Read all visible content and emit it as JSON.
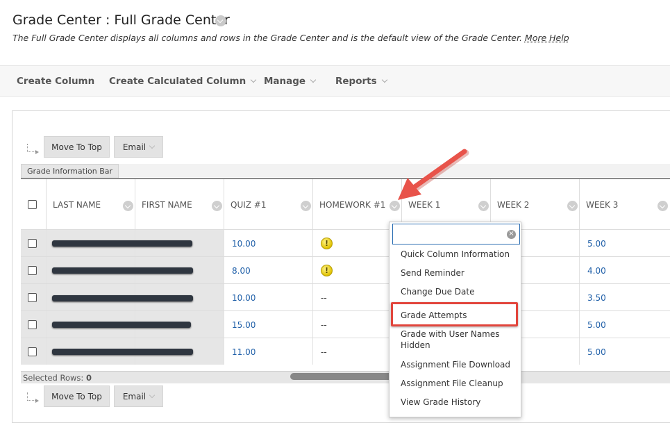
{
  "header": {
    "title": "Grade Center : Full Grade Center",
    "description": "The Full Grade Center displays all columns and rows in the Grade Center and is the default view of the Grade Center.",
    "more_help": "More Help"
  },
  "action_bar": {
    "create_column": "Create Column",
    "create_calculated_column": "Create Calculated Column",
    "manage": "Manage",
    "reports": "Reports"
  },
  "toolbar": {
    "move_to_top": "Move To Top",
    "email": "Email"
  },
  "info_bar": {
    "label": "Grade Information Bar"
  },
  "columns": [
    "LAST NAME",
    "FIRST NAME",
    "QUIZ #1",
    "HOMEWORK #1",
    "WEEK 1",
    "WEEK 2",
    "WEEK 3"
  ],
  "rows": [
    {
      "quiz1": "10.00",
      "homework1": "!",
      "week3": "5.00"
    },
    {
      "quiz1": "8.00",
      "homework1": "!",
      "week3": "4.00"
    },
    {
      "quiz1": "10.00",
      "homework1": "--",
      "week3": "3.50"
    },
    {
      "quiz1": "15.00",
      "homework1": "--",
      "week3": "5.00"
    },
    {
      "quiz1": "11.00",
      "homework1": "--",
      "week3": "5.00"
    }
  ],
  "footer": {
    "selected_rows_label": "Selected Rows:",
    "selected_rows_count": "0"
  },
  "context_menu": {
    "search_clear": "×",
    "items": [
      "Quick Column Information",
      "Send Reminder",
      "Change Due Date",
      "Grade Attempts",
      "Grade with User Names Hidden",
      "Assignment File Download",
      "Assignment File Cleanup",
      "View Grade History"
    ]
  },
  "colors": {
    "link": "#1f5fa8",
    "highlight": "#e2453c",
    "arrow": "#e8534a"
  }
}
